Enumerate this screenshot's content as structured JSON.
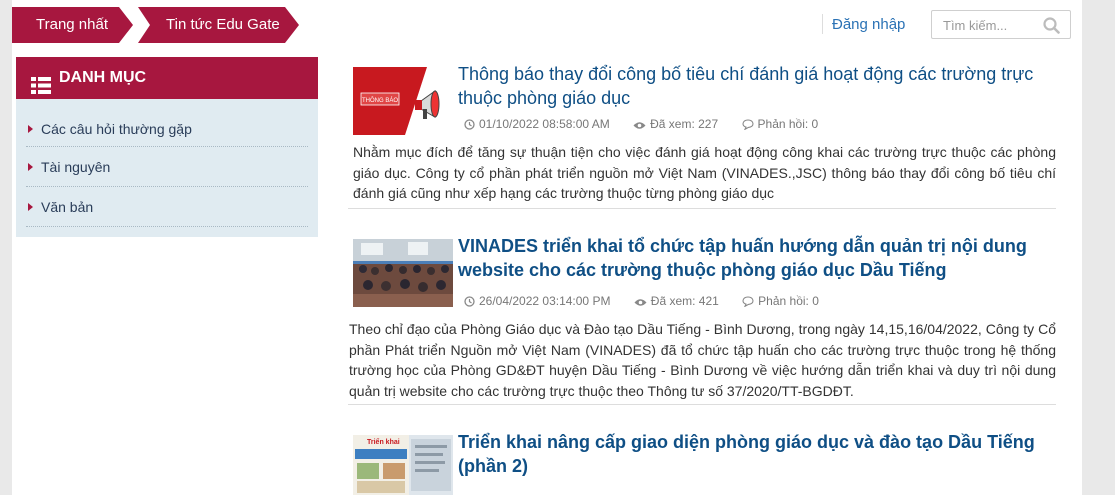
{
  "breadcrumb": {
    "home": "Trang nhất",
    "section": "Tin tức Edu Gate"
  },
  "header": {
    "login": "Đăng nhập",
    "search_placeholder": "Tìm kiếm..."
  },
  "sidebar": {
    "title": "DANH MỤC",
    "items": [
      {
        "label": "Các câu hỏi thường gặp"
      },
      {
        "label": "Tài nguyên"
      },
      {
        "label": "Văn bản"
      }
    ]
  },
  "news": [
    {
      "thumb_label": "THÔNG BÁO",
      "title": "Thông báo thay đổi công bố tiêu chí đánh giá hoạt động các trường trực thuộc phòng giáo dục",
      "date": "01/10/2022 08:58:00 AM",
      "views": "Đã xem: 227",
      "replies": "Phản hồi: 0",
      "summary": "Nhằm mục đích để tăng sự thuận tiện cho việc đánh giá hoạt động công khai các trường trực thuộc các phòng giáo dục. Công ty cổ phần phát triển nguồn mở Việt Nam (VINADES.,JSC) thông báo thay đổi công bố tiêu chí đánh giá cũng như xếp hạng các trường thuộc từng phòng giáo dục"
    },
    {
      "title": "VINADES triển khai tổ chức tập huấn hướng dẫn quản trị nội dung website cho các trường thuộc phòng giáo dục Dầu Tiếng",
      "date": "26/04/2022 03:14:00 PM",
      "views": "Đã xem: 421",
      "replies": "Phản hồi: 0",
      "summary": "Theo chỉ đạo của Phòng Giáo dục và Đào tạo Dầu Tiếng - Bình Dương, trong ngày 14,15,16/04/2022, Công ty Cổ phần Phát triển Nguồn mở Việt Nam (VINADES) đã tổ chức tập huấn cho các trường trực thuộc trong hệ thống trường học của Phòng GD&ĐT huyện Dầu Tiếng - Bình Dương về việc hướng dẫn triển khai và duy trì nội dung quản trị website cho các trường trực thuộc theo Thông tư số 37/2020/TT-BGDĐT."
    },
    {
      "thumb_label": "Triển khai",
      "title": "Triển khai nâng cấp giao diện phòng giáo dục và đào tạo Dầu Tiếng (phần 2)"
    }
  ],
  "colors": {
    "brand": "#a7173f",
    "link": "#0f4f85",
    "sidebar_bg": "#e0ebf1"
  }
}
